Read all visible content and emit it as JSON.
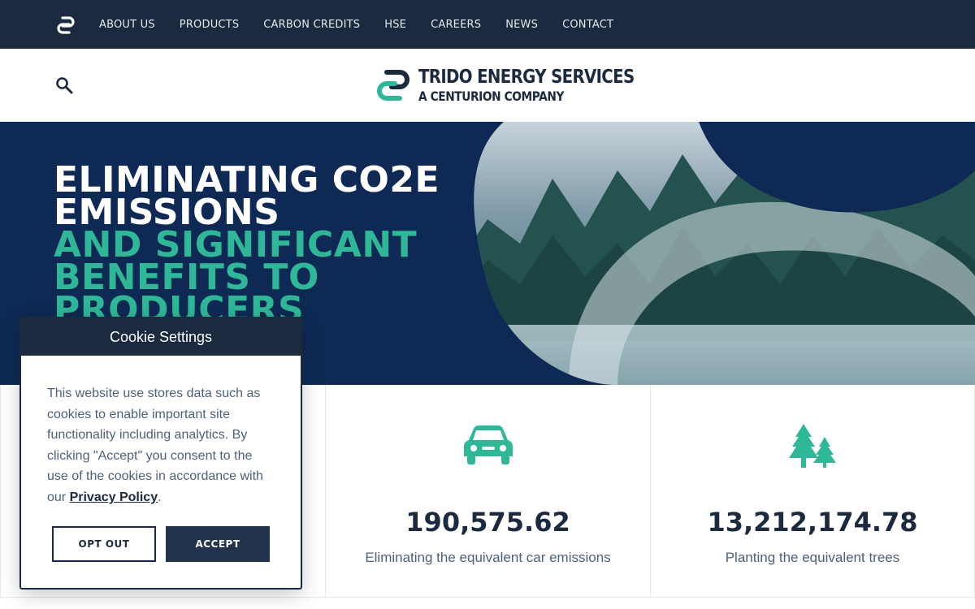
{
  "nav": {
    "items": [
      "ABOUT US",
      "PRODUCTS",
      "CARBON CREDITS",
      "HSE",
      "CAREERS",
      "NEWS",
      "CONTACT"
    ]
  },
  "brand": {
    "name": "TRIDO ENERGY SERVICES",
    "tagline": "A CENTURION COMPANY"
  },
  "hero": {
    "title_lines_white": [
      "ELIMINATING CO2E",
      "EMISSIONS"
    ],
    "title_lines_green": [
      "AND SIGNIFICANT",
      "BENEFITS TO",
      "PRODUCERS"
    ]
  },
  "stats": [
    {
      "icon": "car-icon",
      "value": "190,575.62",
      "caption": "Eliminating the equivalent car emissions"
    },
    {
      "icon": "trees-icon",
      "value": "13,212,174.78",
      "caption": "Planting the equivalent trees"
    }
  ],
  "cookie": {
    "title": "Cookie Settings",
    "body_text": "This website use stores data such as cookies to enable important site functionality including analytics. By clicking \"Accept\" you consent to the use of the cookies in accordance with our",
    "policy_link": "Privacy Policy",
    "body_end": ".",
    "opt_out_label": "OPT OUT",
    "accept_label": "ACCEPT"
  },
  "colors": {
    "navy": "#1b2a3f",
    "accent_green": "#2fb897",
    "hero_blue": "#0e2a54"
  }
}
